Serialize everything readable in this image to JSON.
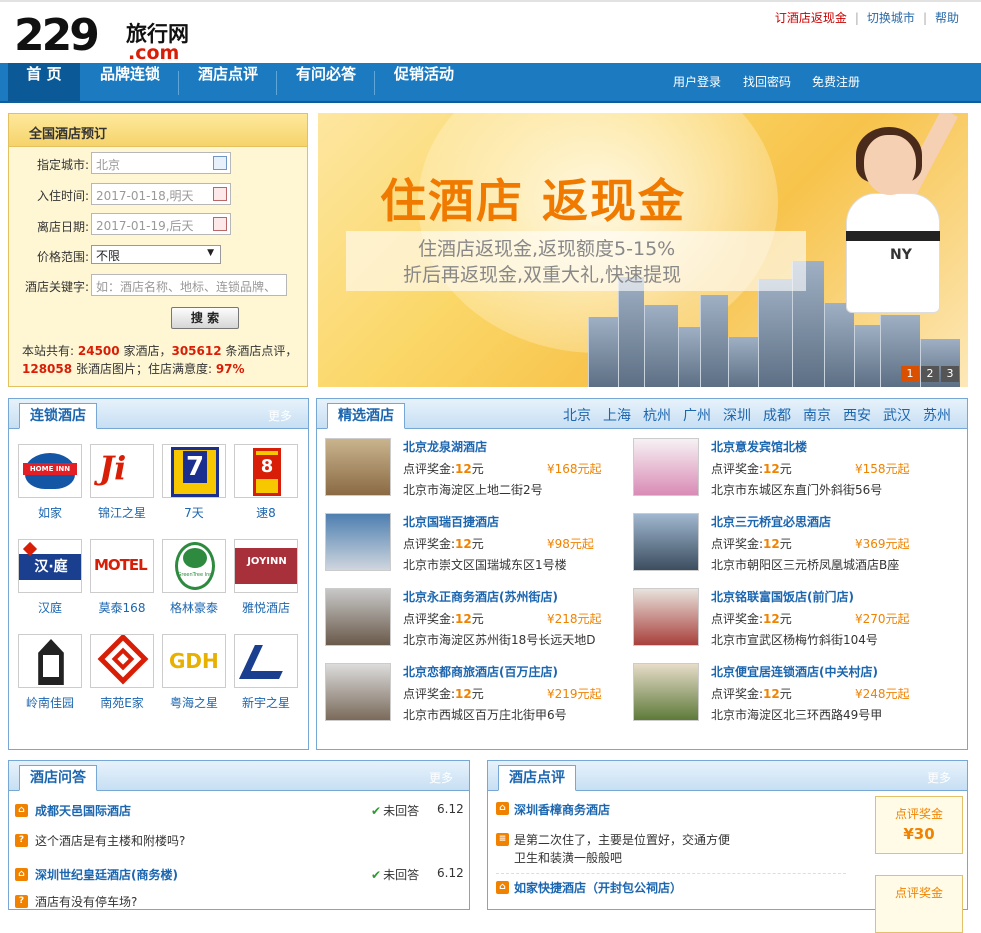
{
  "logo": {
    "num": "229",
    "cn": "旅行网",
    "com": ".com"
  },
  "top_links": [
    "订酒店返现金",
    "切换城市",
    "帮助"
  ],
  "nav": {
    "items": [
      "首 页",
      "品牌连锁",
      "酒店点评",
      "有问必答",
      "促销活动"
    ],
    "right": [
      "用户登录",
      "找回密码",
      "免费注册"
    ]
  },
  "search": {
    "title": "全国酒店预订",
    "city_label": "指定城市:",
    "city_value": "北京",
    "checkin_label": "入住时间:",
    "checkin_value": "2017-01-18,明天",
    "checkout_label": "离店日期:",
    "checkout_value": "2017-01-19,后天",
    "price_label": "价格范围:",
    "price_value": "不限",
    "keyword_label": "酒店关键字:",
    "keyword_placeholder": "如：酒店名称、地标、连锁品牌、",
    "button": "搜 索",
    "stats": {
      "p1": "本站共有:",
      "hotels": "24500",
      "p2": "家酒店，",
      "reviews": "305612",
      "p3": "条酒店点评，",
      "photos": "128058",
      "p4": "张酒店图片；住店满意度:",
      "satisfaction": "97%"
    }
  },
  "banner": {
    "headline": "住酒店 返现金",
    "line1": "住酒店返现金,返现额度5-15%",
    "line2": "折后再返现金,双重大礼,快速提现",
    "shirt_text": "NY",
    "pages": [
      "1",
      "2",
      "3"
    ]
  },
  "chain": {
    "title": "连锁酒店",
    "more": "更多",
    "brands": [
      {
        "name": "如家",
        "logo_text": "HOME INN"
      },
      {
        "name": "锦江之星",
        "logo_text": "Ji"
      },
      {
        "name": "7天",
        "logo_text": "7"
      },
      {
        "name": "速8",
        "logo_text": "8"
      },
      {
        "name": "汉庭",
        "logo_text": "汉·庭"
      },
      {
        "name": "莫泰168",
        "logo_text": "MOTEL"
      },
      {
        "name": "格林豪泰",
        "logo_text": "GreenTree Inn"
      },
      {
        "name": "雅悦酒店",
        "logo_text": "JOYINN"
      },
      {
        "name": "岭南佳园",
        "logo_text": ""
      },
      {
        "name": "南苑E家",
        "logo_text": ""
      },
      {
        "name": "粤海之星",
        "logo_text": "GDH"
      },
      {
        "name": "新宇之星",
        "logo_text": ""
      }
    ]
  },
  "featured": {
    "title": "精选酒店",
    "cities": [
      "北京",
      "上海",
      "杭州",
      "广州",
      "深圳",
      "成都",
      "南京",
      "西安",
      "武汉",
      "苏州"
    ],
    "bonus_label": "点评奖金:",
    "bonus_value": "12",
    "bonus_unit": "元",
    "hotels": [
      {
        "name": "北京龙泉湖酒店",
        "price": "¥168元起",
        "addr": "北京市海淀区上地二街2号"
      },
      {
        "name": "北京意发宾馆北楼",
        "price": "¥158元起",
        "addr": "北京市东城区东直门外斜街56号"
      },
      {
        "name": "北京国瑞百捷酒店",
        "price": "¥98元起",
        "addr": "北京市崇文区国瑞城东区1号楼"
      },
      {
        "name": "北京三元桥宜必思酒店",
        "price": "¥369元起",
        "addr": "北京市朝阳区三元桥凤凰城酒店B座"
      },
      {
        "name": "北京永正商务酒店(苏州街店)",
        "price": "¥218元起",
        "addr": "北京市海淀区苏州街18号长远天地D"
      },
      {
        "name": "北京铭联富国饭店(前门店)",
        "price": "¥270元起",
        "addr": "北京市宣武区杨梅竹斜街104号"
      },
      {
        "name": "北京恋都商旅酒店(百万庄店)",
        "price": "¥219元起",
        "addr": "北京市西城区百万庄北街甲6号"
      },
      {
        "name": "北京便宜居连锁酒店(中关村店)",
        "price": "¥248元起",
        "addr": "北京市海淀区北三环西路49号甲"
      }
    ]
  },
  "qa": {
    "title": "酒店问答",
    "more": "更多",
    "rows": [
      {
        "type": "hotel",
        "text": "成都天邑国际酒店",
        "status": "未回答",
        "date": "6.12"
      },
      {
        "type": "question",
        "text": "这个酒店是有主楼和附楼吗?"
      },
      {
        "type": "hotel",
        "text": "深圳世纪皇廷酒店(商务楼)",
        "status": "未回答",
        "date": "6.12"
      },
      {
        "type": "question",
        "text": "酒店有没有停车场?"
      }
    ]
  },
  "reviews": {
    "title": "酒店点评",
    "more": "更多",
    "items": [
      {
        "hotel": "深圳香樟商务酒店",
        "text1": "是第二次住了，主要是位置好，交通方便",
        "text2": "卫生和装潢一般般吧",
        "award_label": "点评奖金",
        "award_value": "¥30"
      },
      {
        "hotel": "如家快捷酒店（开封包公祠店）",
        "award_label": "点评奖金"
      }
    ]
  }
}
